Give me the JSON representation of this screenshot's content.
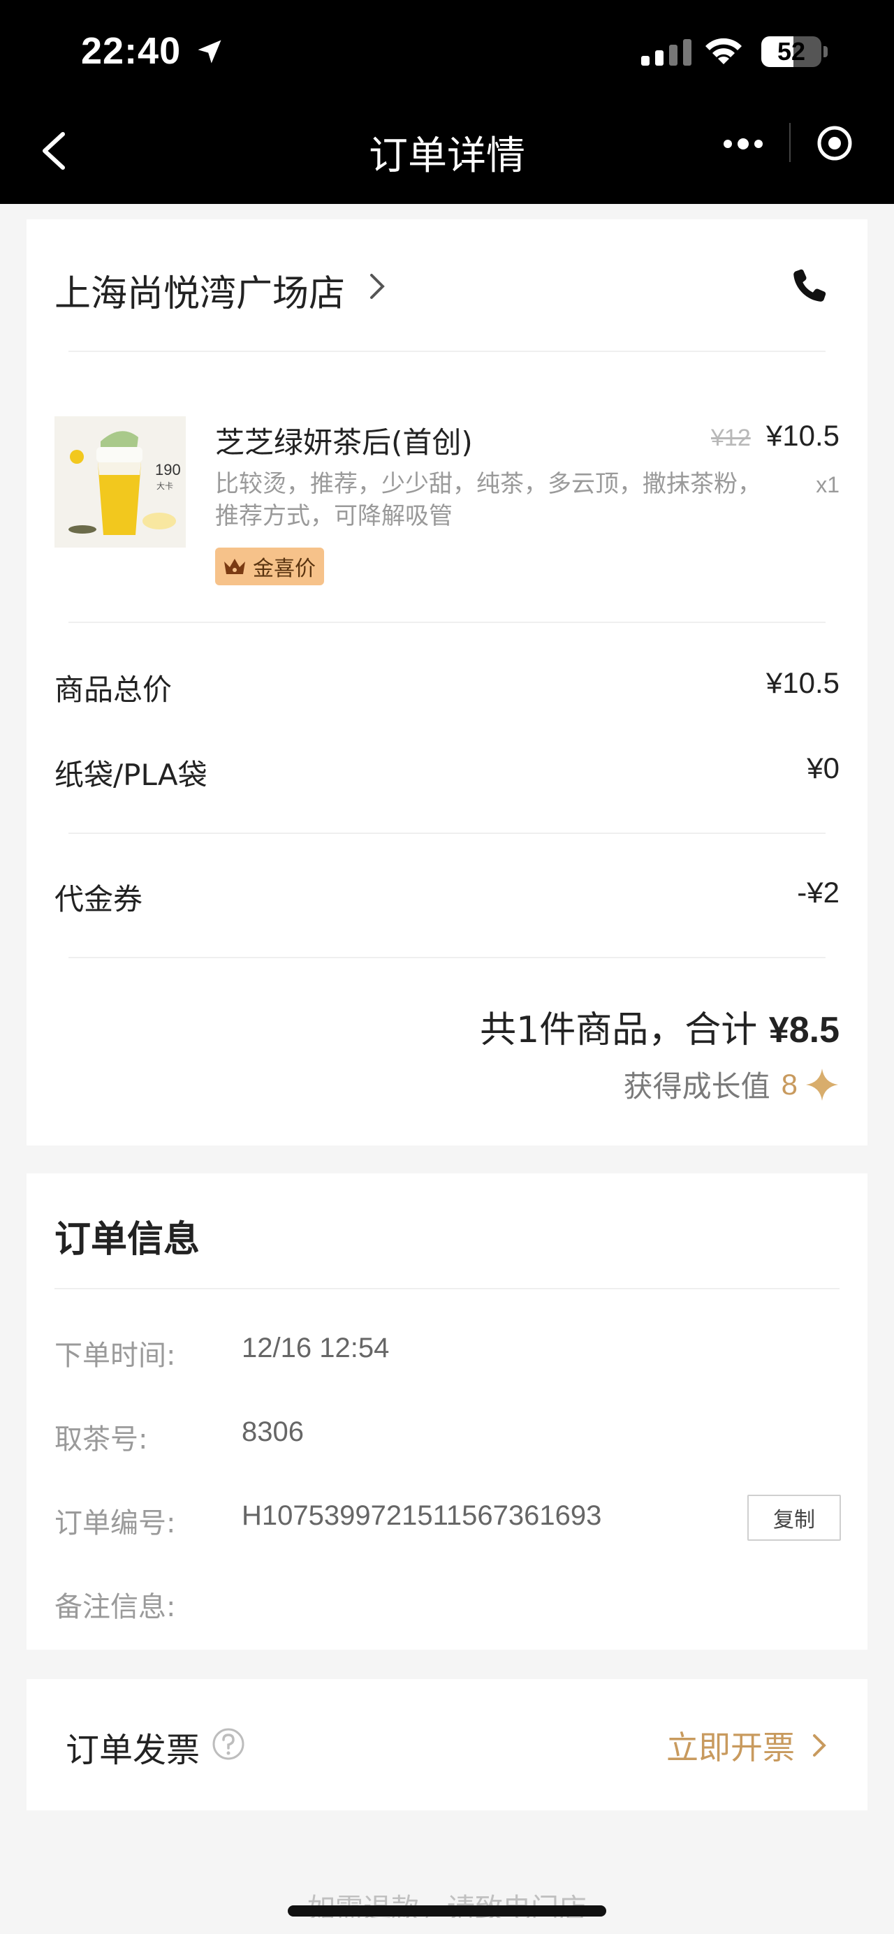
{
  "status_bar": {
    "time": "22:40",
    "battery": "52"
  },
  "nav": {
    "title": "订单详情"
  },
  "store": {
    "name": "上海尚悦湾广场店"
  },
  "product": {
    "name": "芝芝绿妍茶后(首创)",
    "original_price": "¥12",
    "price": "¥10.5",
    "options": "比较烫，推荐，少少甜，纯茶，多云顶，撒抹茶粉，推荐方式，可降解吸管",
    "quantity": "x1",
    "badge": "金喜价",
    "image_text": {
      "cal": "190",
      "size": "大卡"
    }
  },
  "summary": {
    "subtotal_label": "商品总价",
    "subtotal_value": "¥10.5",
    "bag_label": "纸袋/PLA袋",
    "bag_value": "¥0",
    "voucher_label": "代金券",
    "voucher_value": "-¥2",
    "total_prefix": "共1件商品，合计 ",
    "total_amount": "¥8.5",
    "growth_label": "获得成长值",
    "growth_value": "8"
  },
  "order_info": {
    "title": "订单信息",
    "time_label": "下单时间:",
    "time_value": "12/16 12:54",
    "pickup_label": "取茶号:",
    "pickup_value": "8306",
    "order_no_label": "订单编号:",
    "order_no_value": "H107539972151156736​1693",
    "copy_label": "复制",
    "remark_label": "备注信息:"
  },
  "invoice": {
    "label": "订单发票",
    "action": "立即开票"
  },
  "footer": {
    "note": "如需退款，请致电门店"
  },
  "colors": {
    "accent_gold": "#c89a5e",
    "badge_bg": "#f6c28a",
    "page_bg": "#f5f5f5"
  }
}
